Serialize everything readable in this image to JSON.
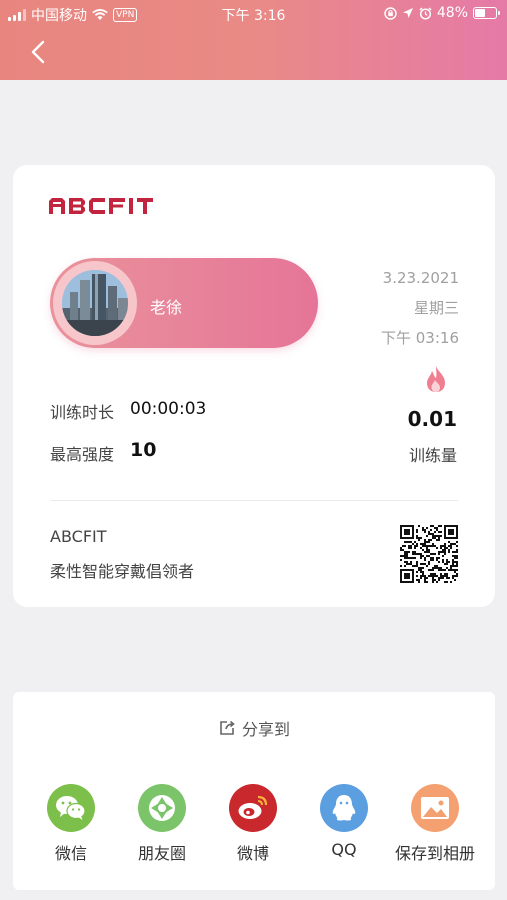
{
  "status_bar": {
    "carrier": "中国移动",
    "vpn": "VPN",
    "time": "下午 3:16",
    "battery": "48%",
    "battery_level": 0.48
  },
  "card": {
    "logo_text": "ABCFIT",
    "user_name": "老徐",
    "date": "3.23.2021",
    "weekday": "星期三",
    "time": "下午 03:16",
    "duration_label": "训练时长",
    "duration_value": "00:00:03",
    "intensity_label": "最高强度",
    "intensity_value": "10",
    "load_value": "0.01",
    "load_label": "训练量",
    "brand": "ABCFIT",
    "slogan": "柔性智能穿戴倡领者"
  },
  "share": {
    "title": "分享到",
    "items": [
      {
        "label": "微信",
        "color": "#7cbf4a",
        "icon": "wechat-icon"
      },
      {
        "label": "朋友圈",
        "color": "#7cc46a",
        "icon": "moments-icon"
      },
      {
        "label": "微博",
        "color": "#c9282d",
        "icon": "weibo-icon"
      },
      {
        "label": "QQ",
        "color": "#5b9fe0",
        "icon": "qq-icon"
      },
      {
        "label": "保存到相册",
        "color": "#f4a070",
        "icon": "album-icon"
      }
    ]
  },
  "colors": {
    "header_start": "#e8857f",
    "header_end": "#e57aa7",
    "accent": "#c2243f"
  }
}
